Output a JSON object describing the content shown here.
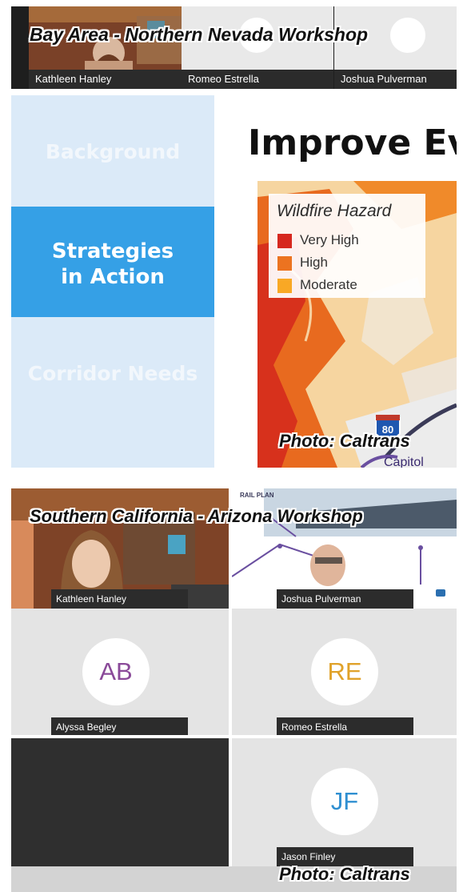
{
  "panel1": {
    "caption": "Bay Area - Northern Nevada Workshop",
    "participants": [
      {
        "name": "Kathleen Hanley"
      },
      {
        "name": "Romeo Estrella"
      },
      {
        "name": "Joshua Pulverman"
      }
    ],
    "sidebar": {
      "items": [
        {
          "label": "Background",
          "active": false
        },
        {
          "label": "Strategies in Action",
          "active": true
        },
        {
          "label": "Corridor Needs",
          "active": false
        }
      ]
    },
    "slide": {
      "title": "Improve Ev",
      "legend": {
        "title": "Wildfire Hazard",
        "items": [
          {
            "label": "Very High",
            "color": "#d6281f"
          },
          {
            "label": "High",
            "color": "#ec7320"
          },
          {
            "label": "Moderate",
            "color": "#f9a825"
          }
        ]
      },
      "route_shield": "80",
      "map_label": "Capitol"
    },
    "credit": "Photo: Caltrans"
  },
  "panel2": {
    "caption": "Southern California - Arizona Workshop",
    "banner_text": "RAIL PLAN",
    "participants": [
      {
        "name": "Kathleen Hanley",
        "initials": "",
        "video": true
      },
      {
        "name": "Joshua Pulverman",
        "initials": "",
        "video": true
      },
      {
        "name": "Alyssa Begley",
        "initials": "AB",
        "color": "#8a4a99"
      },
      {
        "name": "Romeo Estrella",
        "initials": "RE",
        "color": "#e0a22a"
      },
      {
        "name": "Jason Finley",
        "initials": "JF",
        "color": "#2f8fd1"
      }
    ],
    "credit": "Photo: Caltrans"
  },
  "colors": {
    "sidebar_bg": "#dbeaf8",
    "sidebar_active": "#35a0e6",
    "tile_gray": "#e4e4e4",
    "tile_dark": "#2f2f2f"
  }
}
